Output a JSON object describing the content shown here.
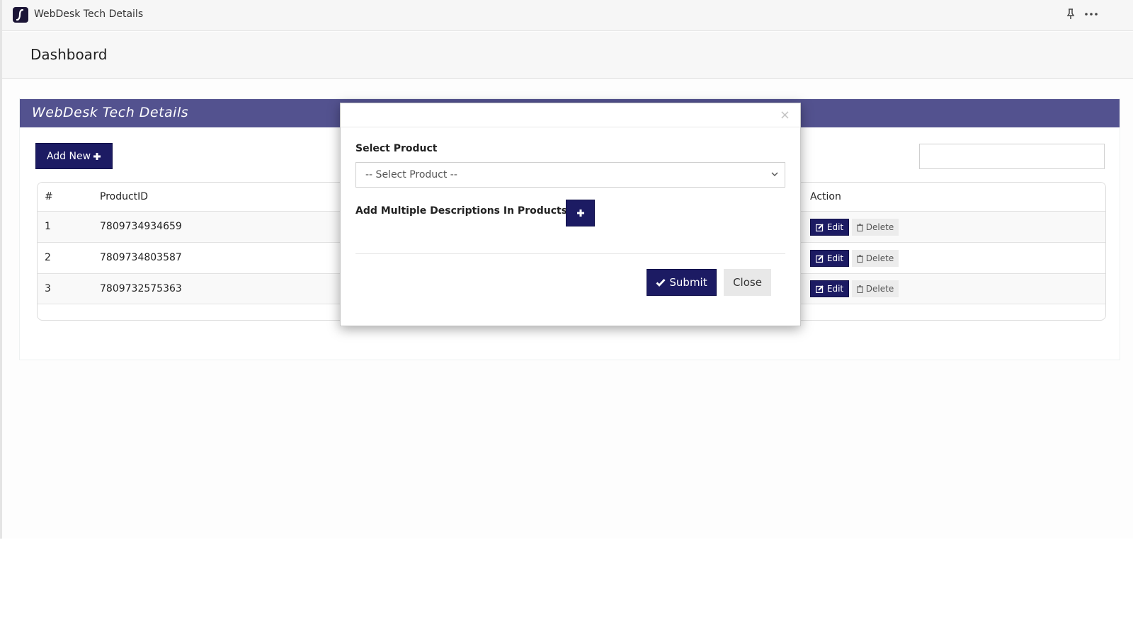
{
  "window": {
    "title": "WebDesk Tech Details",
    "icons": [
      "app-logo-icon",
      "pin-icon",
      "more-icon"
    ]
  },
  "header": {
    "title": "Dashboard"
  },
  "panel": {
    "title": "WebDesk Tech Details",
    "add_button_label": "Add New",
    "search": {
      "value": "",
      "placeholder": ""
    }
  },
  "table": {
    "columns": [
      "#",
      "ProductID",
      "Action"
    ],
    "rows": [
      {
        "index": "1",
        "product_id": "7809734934659"
      },
      {
        "index": "2",
        "product_id": "7809734803587"
      },
      {
        "index": "3",
        "product_id": "7809732575363"
      }
    ],
    "edit_label": "Edit",
    "delete_label": "Delete"
  },
  "modal": {
    "close_glyph": "×",
    "select_label": "Select Product",
    "select_value": "-- Select Product --",
    "multi_label": "Add Multiple Descriptions In Products",
    "submit_label": "Submit",
    "close_label": "Close"
  },
  "colors": {
    "primary": "#1c1b63",
    "panel_heading": "#53528f",
    "secondary_button": "#e8e8e8"
  }
}
